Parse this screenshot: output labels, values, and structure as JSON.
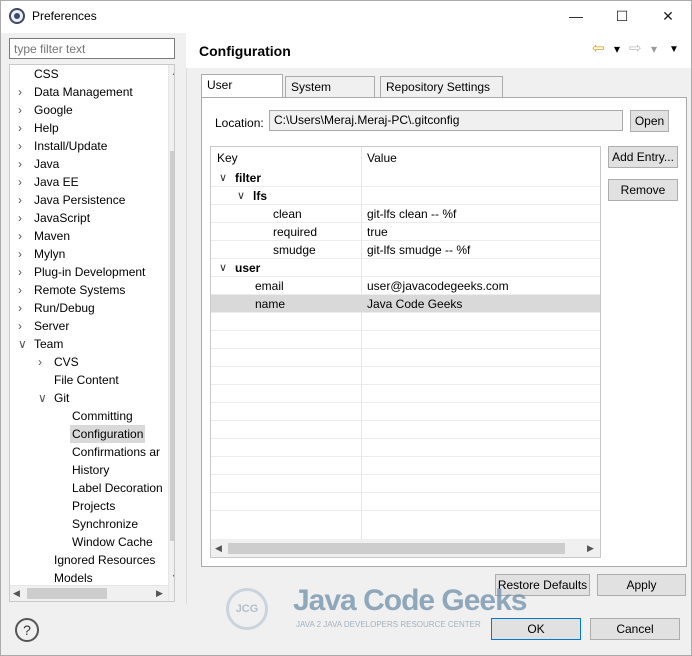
{
  "window": {
    "title": "Preferences",
    "minimize_label": "—",
    "maximize_label": "☐",
    "close_label": "✕"
  },
  "filter": {
    "placeholder": "type filter text"
  },
  "tree": {
    "items": [
      {
        "label": "CSS",
        "level": 1,
        "arrow": "",
        "selected": false
      },
      {
        "label": "Data Management",
        "level": 1,
        "arrow": ">",
        "selected": false
      },
      {
        "label": "Google",
        "level": 1,
        "arrow": ">",
        "selected": false
      },
      {
        "label": "Help",
        "level": 1,
        "arrow": ">",
        "selected": false
      },
      {
        "label": "Install/Update",
        "level": 1,
        "arrow": ">",
        "selected": false
      },
      {
        "label": "Java",
        "level": 1,
        "arrow": ">",
        "selected": false
      },
      {
        "label": "Java EE",
        "level": 1,
        "arrow": ">",
        "selected": false
      },
      {
        "label": "Java Persistence",
        "level": 1,
        "arrow": ">",
        "selected": false
      },
      {
        "label": "JavaScript",
        "level": 1,
        "arrow": ">",
        "selected": false
      },
      {
        "label": "Maven",
        "level": 1,
        "arrow": ">",
        "selected": false
      },
      {
        "label": "Mylyn",
        "level": 1,
        "arrow": ">",
        "selected": false
      },
      {
        "label": "Plug-in Development",
        "level": 1,
        "arrow": ">",
        "selected": false
      },
      {
        "label": "Remote Systems",
        "level": 1,
        "arrow": ">",
        "selected": false
      },
      {
        "label": "Run/Debug",
        "level": 1,
        "arrow": ">",
        "selected": false
      },
      {
        "label": "Server",
        "level": 1,
        "arrow": ">",
        "selected": false
      },
      {
        "label": "Team",
        "level": 1,
        "arrow": "v",
        "selected": false
      },
      {
        "label": "CVS",
        "level": 2,
        "arrow": ">",
        "selected": false
      },
      {
        "label": "File Content",
        "level": 2,
        "arrow": "",
        "selected": false
      },
      {
        "label": "Git",
        "level": 2,
        "arrow": "v",
        "selected": false
      },
      {
        "label": "Committing",
        "level": 3,
        "arrow": "",
        "selected": false
      },
      {
        "label": "Configuration",
        "level": 3,
        "arrow": "",
        "selected": true
      },
      {
        "label": "Confirmations ar",
        "level": 3,
        "arrow": "",
        "selected": false
      },
      {
        "label": "History",
        "level": 3,
        "arrow": "",
        "selected": false
      },
      {
        "label": "Label Decoration",
        "level": 3,
        "arrow": "",
        "selected": false
      },
      {
        "label": "Projects",
        "level": 3,
        "arrow": "",
        "selected": false
      },
      {
        "label": "Synchronize",
        "level": 3,
        "arrow": "",
        "selected": false
      },
      {
        "label": "Window Cache",
        "level": 3,
        "arrow": "",
        "selected": false
      },
      {
        "label": "Ignored Resources",
        "level": 2,
        "arrow": "",
        "selected": false
      },
      {
        "label": "Models",
        "level": 2,
        "arrow": "",
        "selected": false
      }
    ]
  },
  "page": {
    "title": "Configuration",
    "back_icon": "⇦",
    "forward_icon": "⇨",
    "dropdown_icon": "▾",
    "menu_icon": "▼"
  },
  "tabs": [
    "User Settings",
    "System Settings",
    "Repository Settings"
  ],
  "location": {
    "label": "Location:",
    "value": "C:\\Users\\Meraj.Meraj-PC\\.gitconfig",
    "open_label": "Open"
  },
  "table": {
    "headers": [
      "Key",
      "Value"
    ],
    "rows": [
      {
        "key": "filter",
        "value": "",
        "level": 0,
        "expander": "v",
        "bold": true,
        "selected": false
      },
      {
        "key": "lfs",
        "value": "",
        "level": 1,
        "expander": "v",
        "bold": true,
        "selected": false
      },
      {
        "key": "clean",
        "value": "git-lfs clean -- %f",
        "level": 3,
        "expander": "",
        "bold": false,
        "selected": false
      },
      {
        "key": "required",
        "value": "true",
        "level": 3,
        "expander": "",
        "bold": false,
        "selected": false
      },
      {
        "key": "smudge",
        "value": "git-lfs smudge -- %f",
        "level": 3,
        "expander": "",
        "bold": false,
        "selected": false
      },
      {
        "key": "user",
        "value": "",
        "level": 0,
        "expander": "v",
        "bold": true,
        "selected": false
      },
      {
        "key": "email",
        "value": "user@javacodegeeks.com",
        "level": 2,
        "expander": "",
        "bold": false,
        "selected": false
      },
      {
        "key": "name",
        "value": "Java Code Geeks",
        "level": 2,
        "expander": "",
        "bold": false,
        "selected": true
      }
    ],
    "empty_rows": 11
  },
  "side_buttons": {
    "add_entry": "Add Entry...",
    "remove": "Remove"
  },
  "footer": {
    "restore_defaults": "Restore Defaults",
    "apply": "Apply",
    "ok": "OK",
    "cancel": "Cancel",
    "help_icon": "?"
  },
  "watermark": {
    "logo_text": "JCG",
    "title": "Java Code Geeks",
    "subtitle": "JAVA 2 JAVA DEVELOPERS RESOURCE CENTER"
  }
}
